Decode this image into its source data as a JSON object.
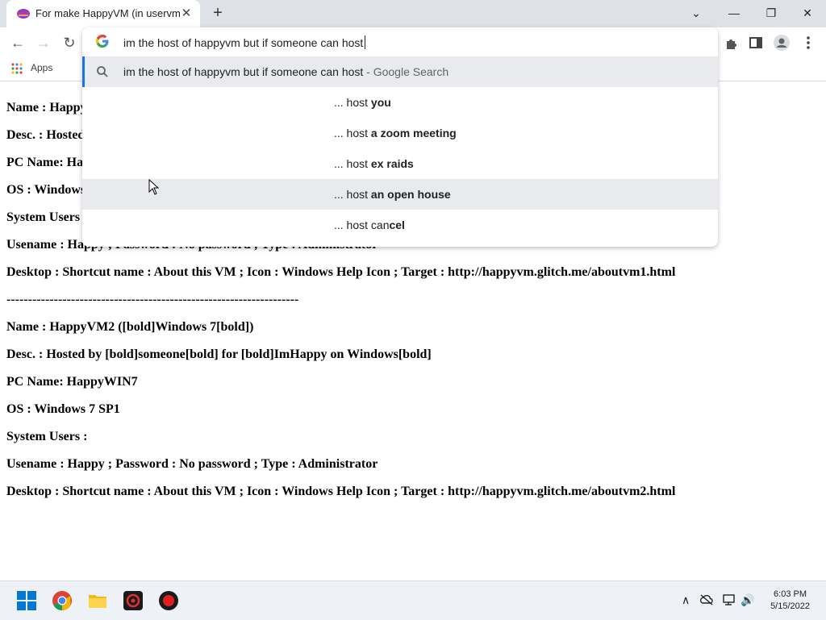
{
  "browser": {
    "tab_title": "For make HappyVM (in uservm)",
    "tab_close": "✕",
    "new_tab": "+",
    "window": {
      "minimize": "—",
      "restore": "❐",
      "close": "✕",
      "dropdown": "⌄"
    },
    "nav": {
      "back": "←",
      "forward": "→",
      "reload": "↻"
    },
    "bookmarks": {
      "apps_label": "Apps"
    }
  },
  "omnibox": {
    "value": "im the host of happyvm but if someone can host",
    "suggestions": [
      {
        "prefix": "im the host of happyvm but if someone can host",
        "suffix": " - Google Search",
        "type": "search",
        "highlighted": true
      },
      {
        "prefix": "... host ",
        "bold": "you",
        "highlighted": false
      },
      {
        "prefix": "... host ",
        "bold": "a zoom meeting",
        "highlighted": false
      },
      {
        "prefix": "... host ",
        "bold": "ex raids",
        "highlighted": false
      },
      {
        "prefix": "... host ",
        "bold": "an open house",
        "highlighted": true
      },
      {
        "prefix": "... host can",
        "bold": "cel",
        "highlighted": false
      }
    ]
  },
  "page": {
    "lines": [
      "Name : Happy",
      "Desc. : Hosted",
      "PC Name: Ha",
      "OS : Windows",
      "System Users",
      "Usename : Happy ; Password : No password ; Type : Administrator",
      "Desktop : Shortcut name : About this VM ; Icon : Windows Help Icon ; Target : http://happyvm.glitch.me/aboutvm1.html",
      "--------------------------------------------------------------------",
      "Name : HappyVM2 ([bold]Windows 7[bold])",
      "Desc. : Hosted by [bold]someone[bold] for [bold]ImHappy on Windows[bold]",
      "PC Name: HappyWIN7",
      "OS : Windows 7 SP1",
      "System Users :",
      "Usename : Happy ; Password : No password ; Type : Administrator",
      "Desktop : Shortcut name : About this VM ; Icon : Windows Help Icon ; Target : http://happyvm.glitch.me/aboutvm2.html"
    ]
  },
  "taskbar": {
    "time": "6:03 PM",
    "date": "5/15/2022",
    "tray": {
      "chevron": "∧",
      "volume": "🔊"
    }
  },
  "colors": {
    "accent": "#1a73e8",
    "tabstrip": "#dee1e6",
    "highlight": "#e8eaed"
  }
}
